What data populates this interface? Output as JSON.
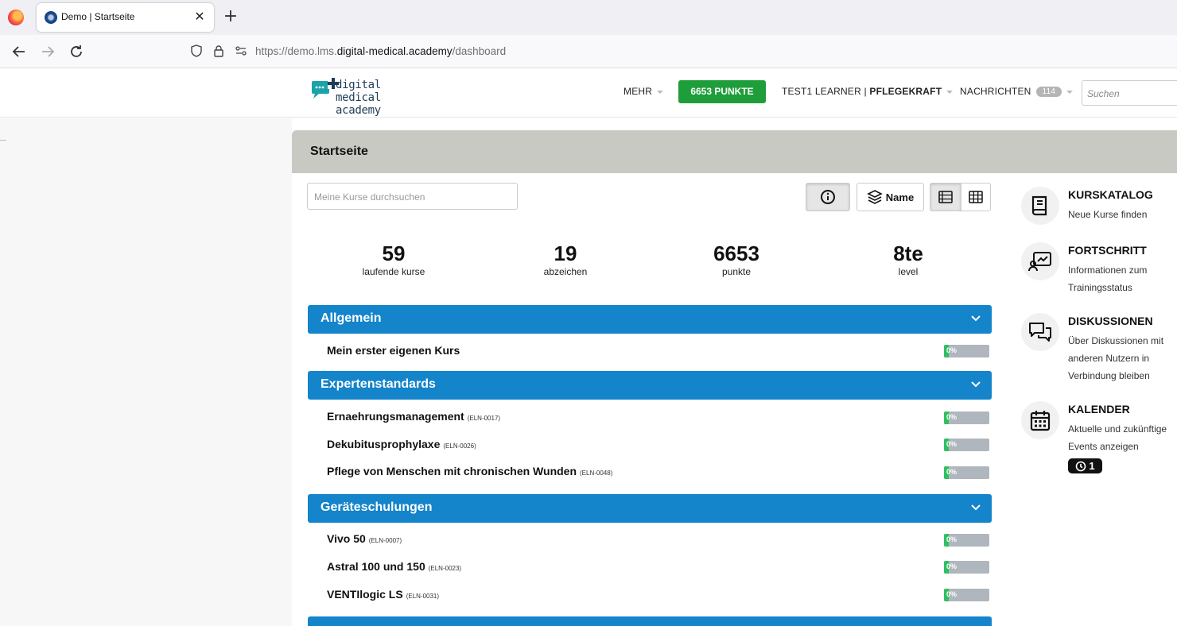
{
  "browser": {
    "tab_title": "Demo | Startseite",
    "url_prefix": "https://demo.lms.",
    "url_host": "digital-medical.academy",
    "url_path": "/dashboard"
  },
  "header": {
    "logo_line1": "digital",
    "logo_line2": "medical academy",
    "menu_more": "MEHR",
    "points_button": "6653 PUNKTE",
    "user_name": "TEST1 LEARNER | ",
    "user_role": "PFLEGEKRAFT",
    "messages_label": "NACHRICHTEN",
    "messages_count": "114",
    "search_placeholder": "Suchen"
  },
  "page": {
    "title": "Startseite",
    "course_search_placeholder": "Meine Kurse durchsuchen",
    "sort_label": "Name"
  },
  "stats": [
    {
      "value": "59",
      "label": "laufende kurse"
    },
    {
      "value": "19",
      "label": "abzeichen"
    },
    {
      "value": "6653",
      "label": "punkte"
    },
    {
      "value": "8te",
      "label": "level"
    }
  ],
  "categories": [
    {
      "title": "Allgemein",
      "courses": [
        {
          "name": "Mein erster eigenen Kurs",
          "code": "",
          "progress": "0%"
        }
      ]
    },
    {
      "title": "Expertenstandards",
      "courses": [
        {
          "name": "Ernaehrungsmanagement",
          "code": "(ELN-0017)",
          "progress": "0%"
        },
        {
          "name": "Dekubitusprophylaxe",
          "code": "(ELN-0026)",
          "progress": "0%"
        },
        {
          "name": "Pflege von Menschen mit chronischen Wunden",
          "code": "(ELN-0048)",
          "progress": "0%"
        }
      ]
    },
    {
      "title": "Geräteschulungen",
      "courses": [
        {
          "name": "Vivo 50",
          "code": "(ELN-0007)",
          "progress": "0%"
        },
        {
          "name": "Astral 100 und 150",
          "code": "(ELN-0023)",
          "progress": "0%"
        },
        {
          "name": "VENTIlogic LS",
          "code": "(ELN-0031)",
          "progress": "0%"
        }
      ]
    }
  ],
  "sidebar": [
    {
      "title": "KURSKATALOG",
      "desc": "Neue Kurse finden",
      "icon": "book-icon"
    },
    {
      "title": "FORTSCHRITT",
      "desc": "Informationen zum Trainingsstatus",
      "icon": "progress-chart-icon"
    },
    {
      "title": "DISKUSSIONEN",
      "desc": "Über Diskussionen mit anderen Nutzern in Verbindung bleiben",
      "icon": "chat-icon"
    },
    {
      "title": "KALENDER",
      "desc": "Aktuelle und zukünftige Events anzeigen",
      "icon": "calendar-icon"
    }
  ],
  "calendar_badge": "1",
  "colors": {
    "accent_blue": "#1484cb",
    "points_green": "#1e9e3a",
    "header_gray": "#c9c9c3"
  }
}
